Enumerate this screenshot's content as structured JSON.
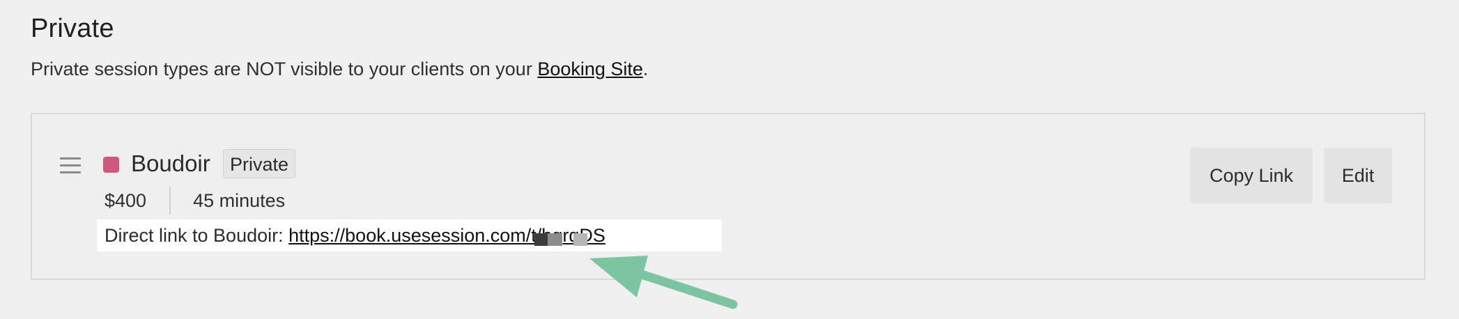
{
  "section": {
    "title": "Private",
    "description_prefix": "Private session types are NOT visible to your clients on your ",
    "booking_site_link": "Booking Site",
    "description_suffix": "."
  },
  "session": {
    "color": "#d0577e",
    "name": "Boudoir",
    "badge": "Private",
    "price": "$400",
    "duration": "45 minutes",
    "direct_link_label": "Direct link to Boudoir:",
    "direct_link_url": "https://book.usesession.com/t/bgrqDS"
  },
  "actions": {
    "copy_link_label": "Copy Link",
    "edit_label": "Edit"
  },
  "annotation": {
    "arrow_color": "#7cc5a1"
  }
}
